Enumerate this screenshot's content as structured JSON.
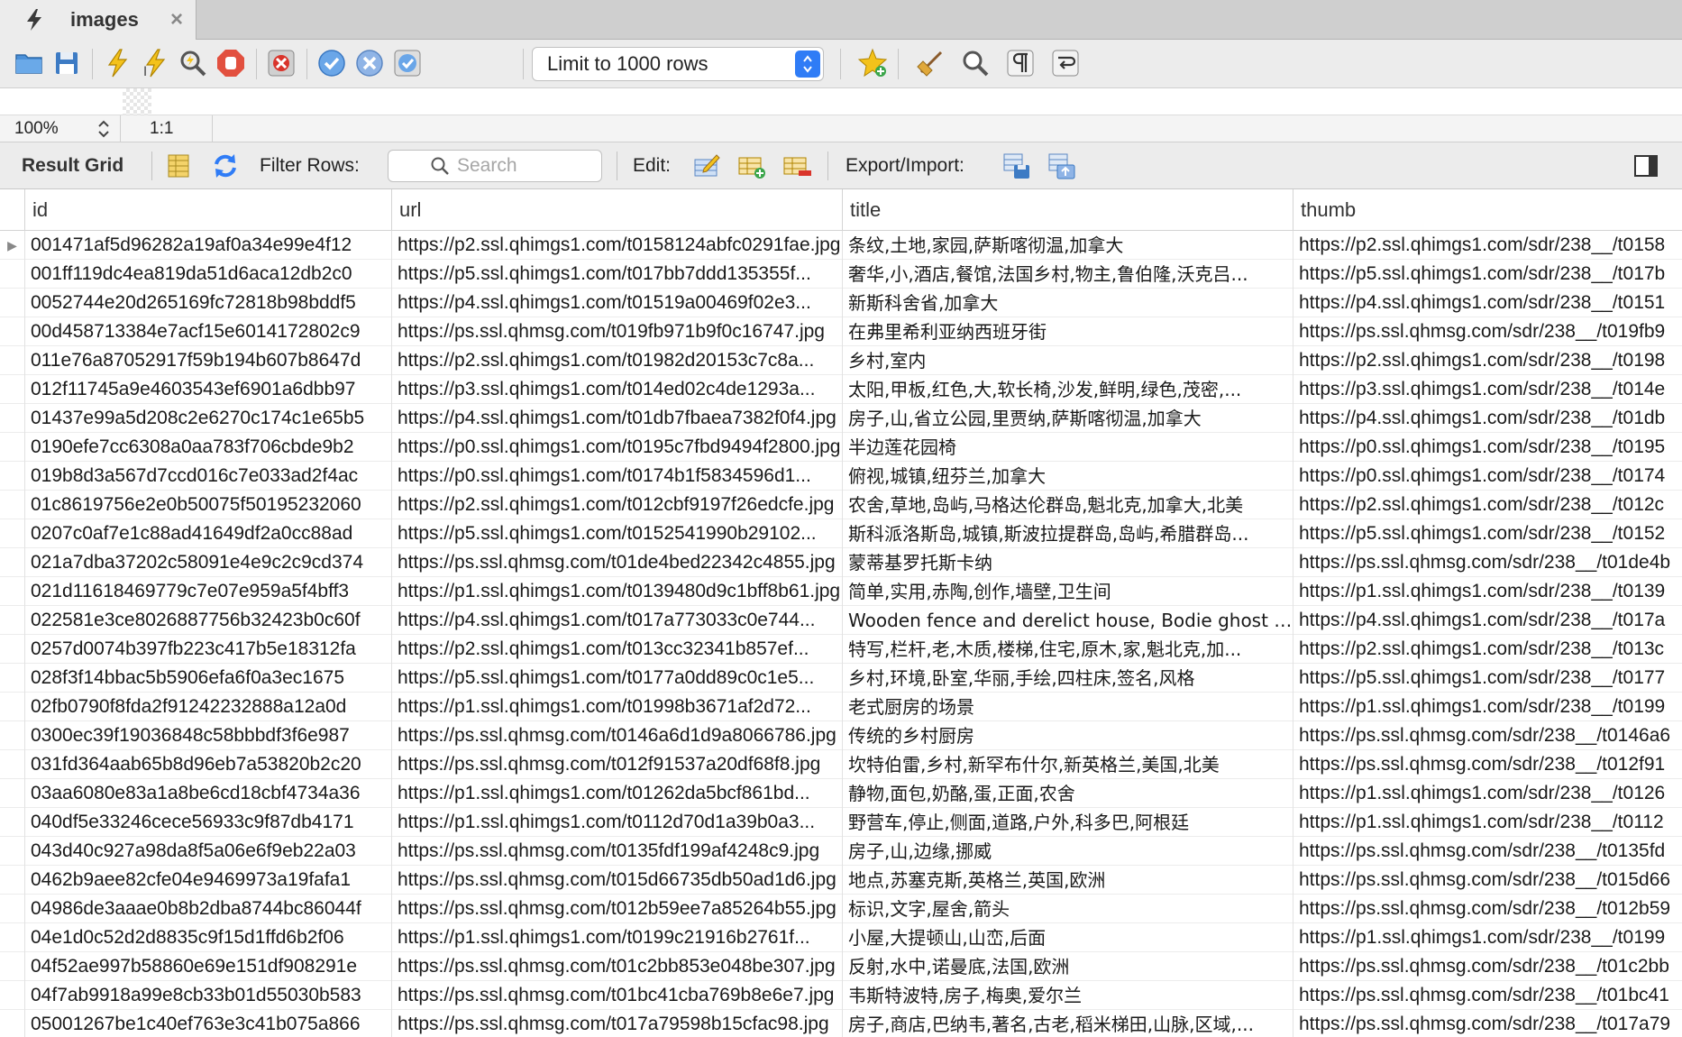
{
  "tab": {
    "title": "images",
    "close": "×"
  },
  "toolbar": {
    "limit_label": "Limit to 1000 rows"
  },
  "zoom": {
    "value": "100%",
    "ratio": "1:1"
  },
  "result_bar": {
    "title": "Result Grid",
    "filter_label": "Filter Rows:",
    "search_placeholder": "Search",
    "edit_label": "Edit:",
    "export_label": "Export/Import:"
  },
  "colors": {
    "accent": "#2f7cf6",
    "toolbar_bg": "#ececec"
  },
  "grid": {
    "columns": [
      "id",
      "url",
      "title",
      "thumb"
    ],
    "rows": [
      [
        "001471af5d96282a19af0a34e99e4f12",
        "https://p2.ssl.qhimgs1.com/t0158124abfc0291fae.jpg",
        "条纹,土地,家园,萨斯喀彻温,加拿大",
        "https://p2.ssl.qhimgs1.com/sdr/238__/t0158"
      ],
      [
        "001ff119dc4ea819da51d6aca12db2c0",
        "https://p5.ssl.qhimgs1.com/t017bb7ddd135355f...",
        "奢华,小,酒店,餐馆,法国乡村,物主,鲁伯隆,沃克吕...",
        "https://p5.ssl.qhimgs1.com/sdr/238__/t017b"
      ],
      [
        "0052744e20d265169fc72818b98bddf5",
        "https://p4.ssl.qhimgs1.com/t01519a00469f02e3...",
        "新斯科舍省,加拿大",
        "https://p4.ssl.qhimgs1.com/sdr/238__/t0151"
      ],
      [
        "00d458713384e7acf15e6014172802c9",
        "https://ps.ssl.qhmsg.com/t019fb971b9f0c16747.jpg",
        "在弗里希利亚纳西班牙街",
        "https://ps.ssl.qhmsg.com/sdr/238__/t019fb9"
      ],
      [
        "011e76a87052917f59b194b607b8647d",
        "https://p2.ssl.qhimgs1.com/t01982d20153c7c8a...",
        "乡村,室内",
        "https://p2.ssl.qhimgs1.com/sdr/238__/t0198"
      ],
      [
        "012f11745a9e4603543ef6901a6dbb97",
        "https://p3.ssl.qhimgs1.com/t014ed02c4de1293a...",
        "太阳,甲板,红色,大,软长椅,沙发,鲜明,绿色,茂密,...",
        "https://p3.ssl.qhimgs1.com/sdr/238__/t014e"
      ],
      [
        "01437e99a5d208c2e6270c174c1e65b5",
        "https://p4.ssl.qhimgs1.com/t01db7fbaea7382f0f4.jpg",
        "房子,山,省立公园,里贾纳,萨斯喀彻温,加拿大",
        "https://p4.ssl.qhimgs1.com/sdr/238__/t01db"
      ],
      [
        "0190efe7cc6308a0aa783f706cbde9b2",
        "https://p0.ssl.qhimgs1.com/t0195c7fbd9494f2800.jpg",
        "半边莲花园椅",
        "https://p0.ssl.qhimgs1.com/sdr/238__/t0195"
      ],
      [
        "019b8d3a567d7ccd016c7e033ad2f4ac",
        "https://p0.ssl.qhimgs1.com/t0174b1f5834596d1...",
        "俯视,城镇,纽芬兰,加拿大",
        "https://p0.ssl.qhimgs1.com/sdr/238__/t0174"
      ],
      [
        "01c8619756e2e0b50075f50195232060",
        "https://p2.ssl.qhimgs1.com/t012cbf9197f26edcfe.jpg",
        "农舍,草地,岛屿,马格达伦群岛,魁北克,加拿大,北美",
        "https://p2.ssl.qhimgs1.com/sdr/238__/t012c"
      ],
      [
        "0207c0af7e1c88ad41649df2a0cc88ad",
        "https://p5.ssl.qhimgs1.com/t0152541990b29102...",
        "斯科派洛斯岛,城镇,斯波拉提群岛,岛屿,希腊群岛...",
        "https://p5.ssl.qhimgs1.com/sdr/238__/t0152"
      ],
      [
        "021a7dba37202c58091e4e9c2c9cd374",
        "https://ps.ssl.qhmsg.com/t01de4bed22342c4855.jpg",
        "蒙蒂基罗托斯卡纳",
        "https://ps.ssl.qhmsg.com/sdr/238__/t01de4b"
      ],
      [
        "021d11618469779c7e07e959a5f4bff3",
        "https://p1.ssl.qhimgs1.com/t0139480d9c1bff8b61.jpg",
        "简单,实用,赤陶,创作,墙壁,卫生间",
        "https://p1.ssl.qhimgs1.com/sdr/238__/t0139"
      ],
      [
        "022581e3ce8026887756b32423b0c60f",
        "https://p4.ssl.qhimgs1.com/t017a773033c0e744...",
        "Wooden fence and derelict house, Bodie ghost town",
        "https://p4.ssl.qhimgs1.com/sdr/238__/t017a"
      ],
      [
        "0257d0074b397fb223c417b5e18312fa",
        "https://p2.ssl.qhimgs1.com/t013cc32341b857ef...",
        "特写,栏杆,老,木质,楼梯,住宅,原木,家,魁北克,加...",
        "https://p2.ssl.qhimgs1.com/sdr/238__/t013c"
      ],
      [
        "028f3f14bbac5b5906efa6f0a3ec1675",
        "https://p5.ssl.qhimgs1.com/t0177a0dd89c0c1e5...",
        "乡村,环境,卧室,华丽,手绘,四柱床,签名,风格",
        "https://p5.ssl.qhimgs1.com/sdr/238__/t0177"
      ],
      [
        "02fb0790f8fda2f91242232888a12a0d",
        "https://p1.ssl.qhimgs1.com/t01998b3671af2d72...",
        "老式厨房的场景",
        "https://p1.ssl.qhimgs1.com/sdr/238__/t0199"
      ],
      [
        "0300ec39f19036848c58bbbdf3f6e987",
        "https://ps.ssl.qhmsg.com/t0146a6d1d9a8066786.jpg",
        "传统的乡村厨房",
        "https://ps.ssl.qhmsg.com/sdr/238__/t0146a6"
      ],
      [
        "031fd364aab65b8d96eb7a53820b2c20",
        "https://ps.ssl.qhmsg.com/t012f91537a20df68f8.jpg",
        "坎特伯雷,乡村,新罕布什尔,新英格兰,美国,北美",
        "https://ps.ssl.qhmsg.com/sdr/238__/t012f91"
      ],
      [
        "03aa6080e83a1a8be6cd18cbf4734a36",
        "https://p1.ssl.qhimgs1.com/t01262da5bcf861bd...",
        "静物,面包,奶酪,蛋,正面,农舍",
        "https://p1.ssl.qhimgs1.com/sdr/238__/t0126"
      ],
      [
        "040df5e33246cece56933c9f87db4171",
        "https://p1.ssl.qhimgs1.com/t0112d70d1a39b0a3...",
        "野营车,停止,侧面,道路,户外,科多巴,阿根廷",
        "https://p1.ssl.qhimgs1.com/sdr/238__/t0112"
      ],
      [
        "043d40c927a98da8f5a06e6f9eb22a03",
        "https://ps.ssl.qhmsg.com/t0135fdf199af4248c9.jpg",
        "房子,山,边缘,挪威",
        "https://ps.ssl.qhmsg.com/sdr/238__/t0135fd"
      ],
      [
        "0462b9aee82cfe04e9469973a19fafa1",
        "https://ps.ssl.qhmsg.com/t015d66735db50ad1d6.jpg",
        "地点,苏塞克斯,英格兰,英国,欧洲",
        "https://ps.ssl.qhmsg.com/sdr/238__/t015d66"
      ],
      [
        "04986de3aaae0b8b2dba8744bc86044f",
        "https://ps.ssl.qhmsg.com/t012b59ee7a85264b55.jpg",
        "标识,文字,屋舍,箭头",
        "https://ps.ssl.qhmsg.com/sdr/238__/t012b59"
      ],
      [
        "04e1d0c52d2d8835c9f15d1ffd6b2f06",
        "https://p1.ssl.qhimgs1.com/t0199c21916b2761f...",
        "小屋,大提顿山,山峦,后面",
        "https://p1.ssl.qhimgs1.com/sdr/238__/t0199"
      ],
      [
        "04f52ae997b58860e69e151df908291e",
        "https://ps.ssl.qhmsg.com/t01c2bb853e048be307.jpg",
        "反射,水中,诺曼底,法国,欧洲",
        "https://ps.ssl.qhmsg.com/sdr/238__/t01c2bb"
      ],
      [
        "04f7ab9918a99e8cb33b01d55030b583",
        "https://ps.ssl.qhmsg.com/t01bc41cba769b8e6e7.jpg",
        "韦斯特波特,房子,梅奥,爱尔兰",
        "https://ps.ssl.qhmsg.com/sdr/238__/t01bc41"
      ],
      [
        "05001267be1c40ef763e3c41b075a866",
        "https://ps.ssl.qhmsg.com/t017a79598b15cfac98.jpg",
        "房子,商店,巴纳韦,著名,古老,稻米梯田,山脉,区域,...",
        "https://ps.ssl.qhmsg.com/sdr/238__/t017a79"
      ]
    ]
  }
}
